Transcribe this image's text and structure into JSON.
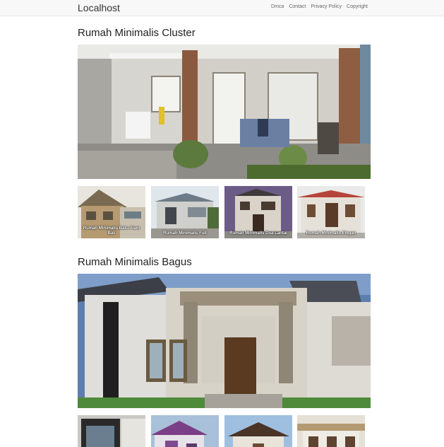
{
  "nav": {
    "brand": "Localhost",
    "links": [
      "Dmca",
      "Contact",
      "Privacy Policy",
      "Copyright"
    ]
  },
  "posts": [
    {
      "title": "Rumah Minimalis Cluster",
      "image_icon": "house-photo",
      "thumbs": [
        "Rumah Minimalis Batu Alam Bali",
        "Rumah Minimalis Full",
        "Rumah Minimalis Dua Lantai",
        "Rumah Minimalis Elegan"
      ]
    },
    {
      "title": "Rumah Minimalis Bagus",
      "image_icon": "house-render",
      "thumbs": [
        "",
        "",
        "",
        ""
      ]
    }
  ]
}
